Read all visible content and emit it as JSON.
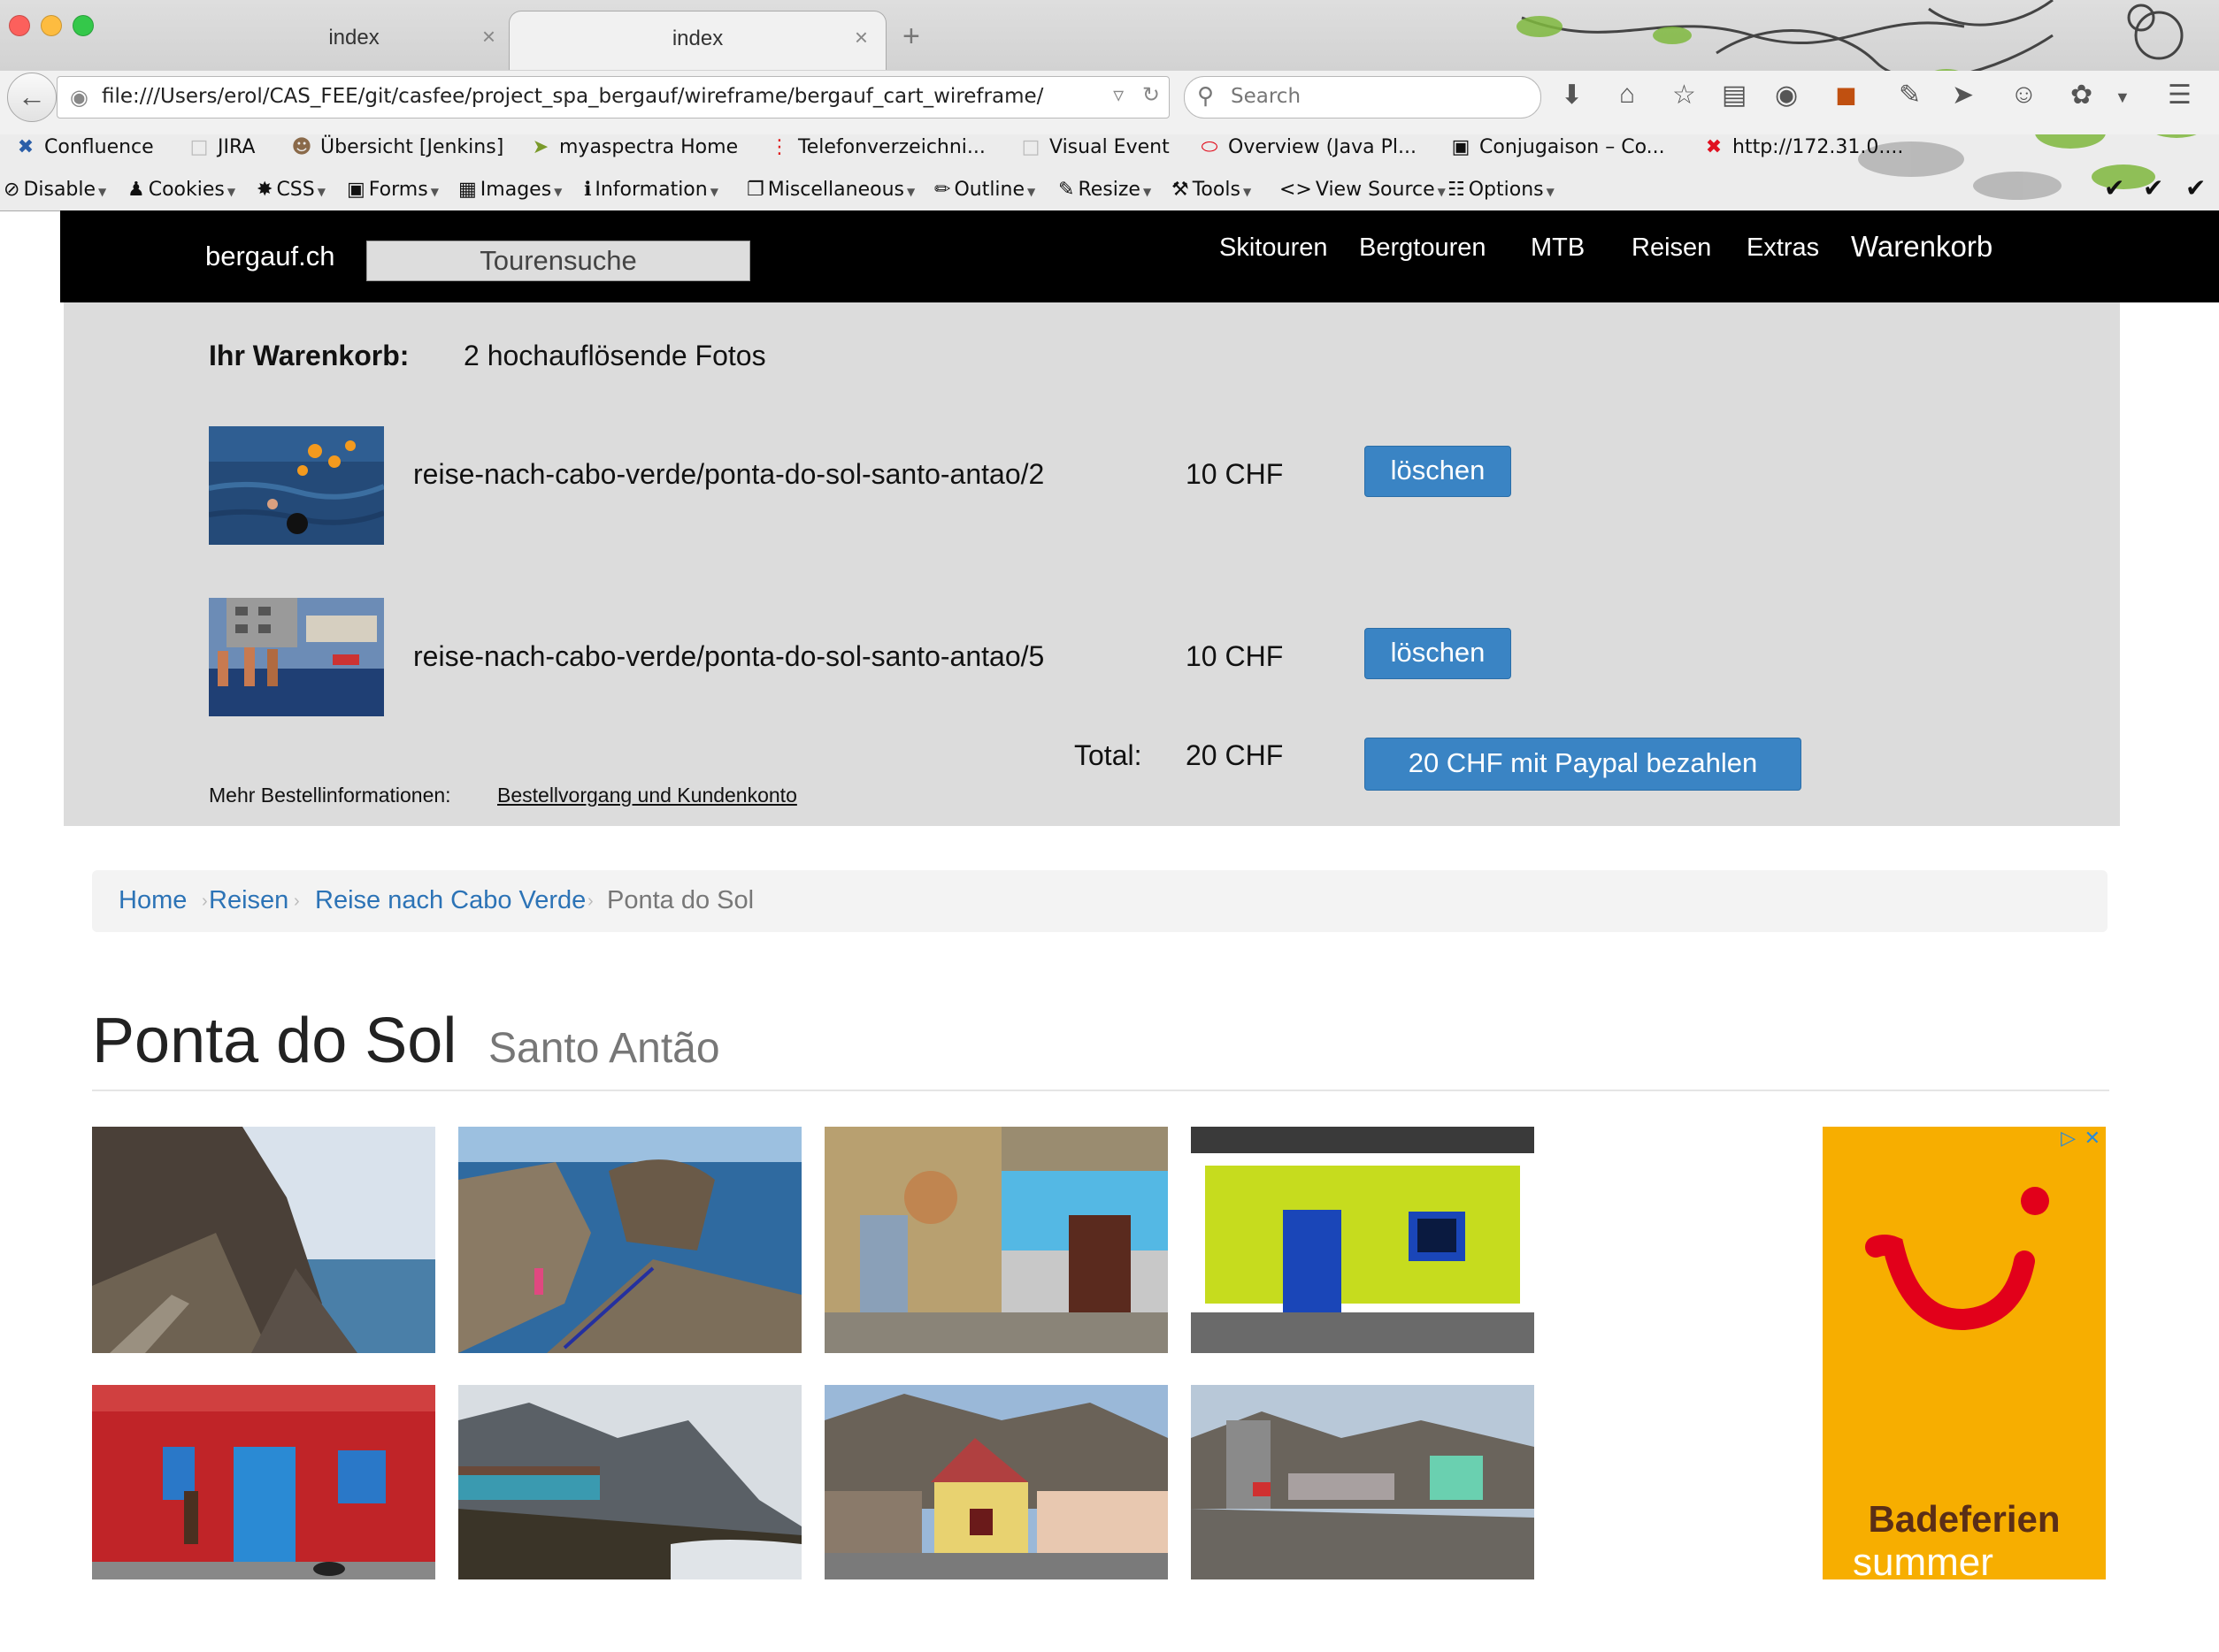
{
  "browser": {
    "tabs": [
      {
        "title": "index",
        "active": false
      },
      {
        "title": "index",
        "active": true
      }
    ],
    "url": "file:///Users/erol/CAS_FEE/git/casfee/project_spa_bergauf/wireframe/bergauf_cart_wireframe/",
    "search_placeholder": "Search",
    "bookmarks": [
      {
        "label": "Confluence",
        "icon": "confluence-icon"
      },
      {
        "label": "JIRA",
        "icon": "page-icon"
      },
      {
        "label": "Übersicht [Jenkins]",
        "icon": "jenkins-icon"
      },
      {
        "label": "myaspectra Home",
        "icon": "bird-icon"
      },
      {
        "label": "Telefonverzeichni...",
        "icon": "red-dots-icon"
      },
      {
        "label": "Visual Event",
        "icon": "page-icon"
      },
      {
        "label": "Overview (Java Pl...",
        "icon": "oracle-icon"
      },
      {
        "label": "Conjugaison – Co...",
        "icon": "book-icon"
      },
      {
        "label": "http://172.31.0....",
        "icon": "x-red-icon"
      }
    ],
    "devtools": [
      {
        "label": "Disable",
        "icon": "no-icon"
      },
      {
        "label": "Cookies",
        "icon": "person-icon"
      },
      {
        "label": "CSS",
        "icon": "wand-icon"
      },
      {
        "label": "Forms",
        "icon": "briefcase-icon"
      },
      {
        "label": "Images",
        "icon": "image-icon"
      },
      {
        "label": "Information",
        "icon": "info-icon"
      },
      {
        "label": "Miscellaneous",
        "icon": "cube-icon"
      },
      {
        "label": "Outline",
        "icon": "pencil-icon"
      },
      {
        "label": "Resize",
        "icon": "resize-icon"
      },
      {
        "label": "Tools",
        "icon": "wrench-icon"
      },
      {
        "label": "View Source",
        "icon": "code-icon"
      },
      {
        "label": "Options",
        "icon": "sliders-icon"
      }
    ]
  },
  "site": {
    "brand": "bergauf.ch",
    "search_button": "Tourensuche",
    "nav": [
      "Skitouren",
      "Bergtouren",
      "MTB",
      "Reisen",
      "Extras",
      "Warenkorb"
    ]
  },
  "cart": {
    "label": "Ihr Warenkorb:",
    "summary": "2 hochauflösende Fotos",
    "items": [
      {
        "name": "reise-nach-cabo-verde/ponta-do-sol-santo-antao/2",
        "price": "10 CHF",
        "delete": "löschen"
      },
      {
        "name": "reise-nach-cabo-verde/ponta-do-sol-santo-antao/5",
        "price": "10 CHF",
        "delete": "löschen"
      }
    ],
    "total_label": "Total:",
    "total_value": "20 CHF",
    "pay_button": "20 CHF mit Paypal bezahlen",
    "more_info_label": "Mehr Bestellinformationen:",
    "more_info_link": "Bestellvorgang und Kundenkonto"
  },
  "breadcrumb": [
    "Home",
    "Reisen",
    "Reise nach Cabo Verde",
    "Ponta do Sol"
  ],
  "page": {
    "title": "Ponta do Sol",
    "subtitle": "Santo Antão"
  },
  "gallery": [
    {
      "name": "coastal-cliff-road"
    },
    {
      "name": "rock-pool-stairs"
    },
    {
      "name": "weathered-wall-doors"
    },
    {
      "name": "yellow-house-blue-door"
    },
    {
      "name": "red-house-blue-doors"
    },
    {
      "name": "houses-by-rocky-shore"
    },
    {
      "name": "village-street-mountains"
    },
    {
      "name": "hillside-village"
    }
  ],
  "ad": {
    "brand_icon": "tui-smile-logo",
    "text1": "Badeferien",
    "text2": "summer",
    "colors": {
      "background": "#f7ae00",
      "logo": "#e2001a"
    }
  },
  "colors": {
    "site_nav": "#000000",
    "cart_panel": "#dcdcdc",
    "button": "#3a84c4",
    "link": "#2c73b6"
  }
}
